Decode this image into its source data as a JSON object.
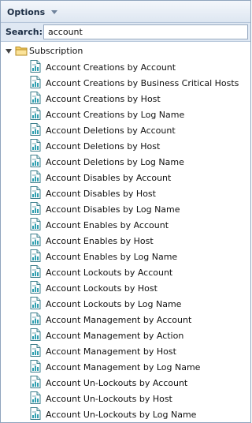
{
  "options": {
    "label": "Options"
  },
  "search": {
    "label": "Search:",
    "value": "account"
  },
  "tree": {
    "folder": {
      "label": "Subscription"
    },
    "items": [
      "Account Creations by Account",
      "Account Creations by Business Critical Hosts",
      "Account Creations by Host",
      "Account Creations by Log Name",
      "Account Deletions by Account",
      "Account Deletions by Host",
      "Account Deletions by Log Name",
      "Account Disables by Account",
      "Account Disables by Host",
      "Account Disables by Log Name",
      "Account Enables by Account",
      "Account Enables by Host",
      "Account Enables by Log Name",
      "Account Lockouts by Account",
      "Account Lockouts by Host",
      "Account Lockouts by Log Name",
      "Account Management by Account",
      "Account Management by Action",
      "Account Management by Host",
      "Account Management by Log Name",
      "Account Un-Lockouts by Account",
      "Account Un-Lockouts by Host",
      "Account Un-Lockouts by Log Name"
    ]
  }
}
